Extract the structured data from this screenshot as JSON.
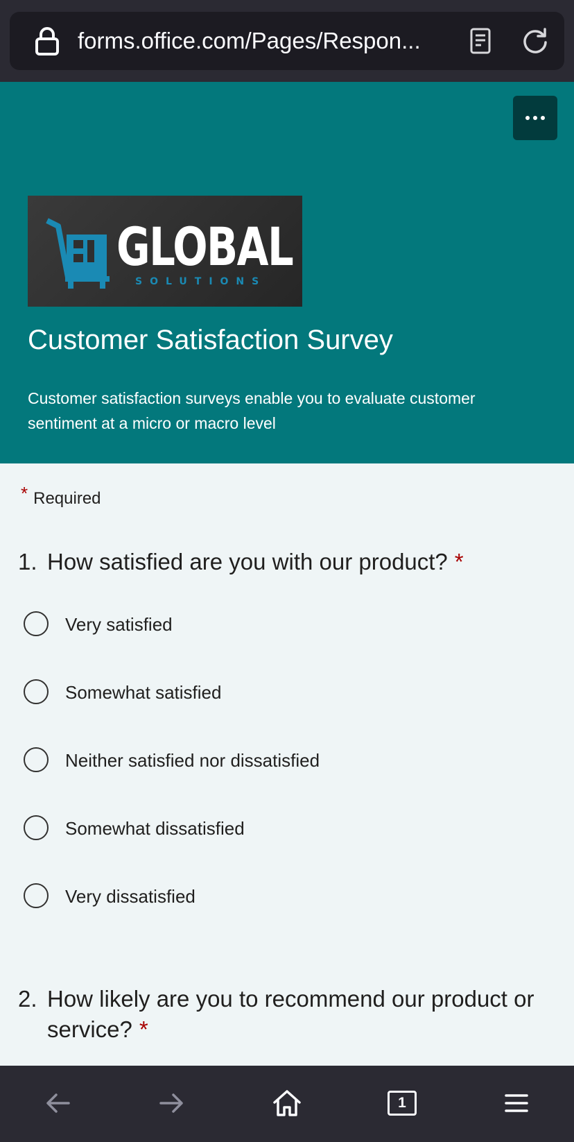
{
  "browser": {
    "url": "forms.office.com/Pages/Respon...",
    "tab_count": "1"
  },
  "colors": {
    "header_bg": "#03787c",
    "page_bg": "#eff5f6",
    "required_star": "#a80000",
    "browser_chrome": "#2b2a33"
  },
  "form": {
    "logo": {
      "brand": "GLOBAL",
      "tagline": "SOLUTIONS"
    },
    "title": "Customer Satisfaction Survey",
    "description": "Customer satisfaction surveys enable you to evaluate customer sentiment at a micro or macro level",
    "required_label": "Required",
    "required_marker": "*",
    "questions": [
      {
        "number": "1.",
        "text": "How satisfied are you with our product?",
        "required": true,
        "options": [
          "Very satisfied",
          "Somewhat satisfied",
          "Neither satisfied nor dissatisfied",
          "Somewhat dissatisfied",
          "Very dissatisfied"
        ]
      },
      {
        "number": "2.",
        "text": "How likely are you to recommend our product or service?",
        "required": true
      }
    ]
  },
  "icons": {
    "lock": "lock-icon",
    "reader": "reader-mode-icon",
    "reload": "reload-icon",
    "more": "more-options-icon",
    "back": "back-arrow-icon",
    "forward": "forward-arrow-icon",
    "home": "home-icon",
    "tabs": "tabs-icon",
    "menu": "hamburger-menu-icon"
  }
}
